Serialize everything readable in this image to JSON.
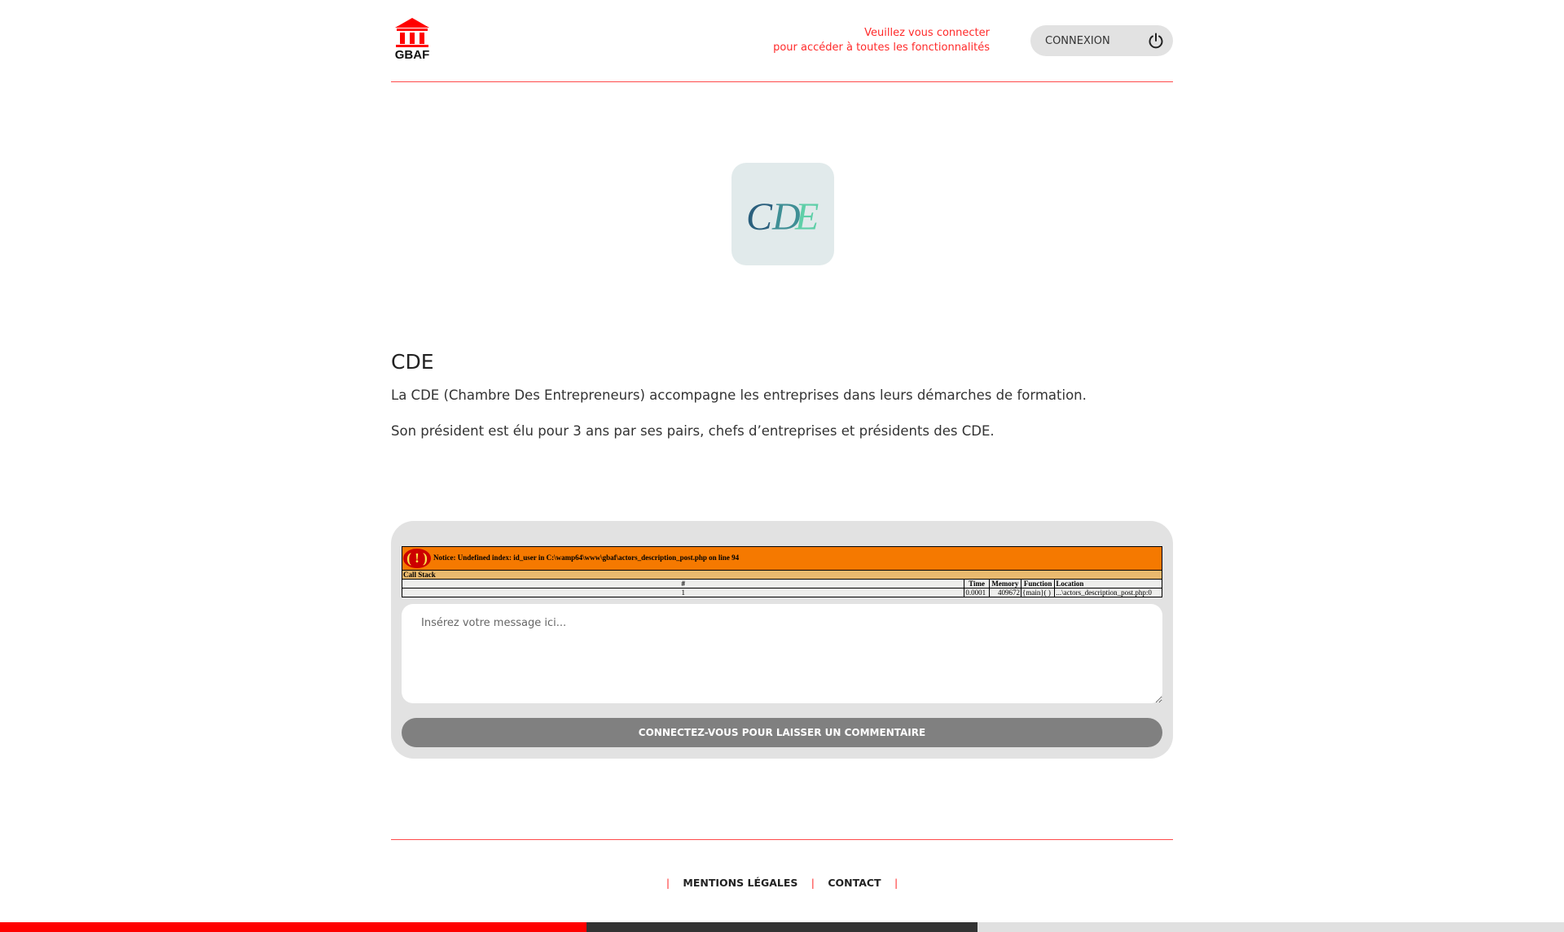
{
  "header": {
    "logo_text": "GBAF",
    "login_message_line1": "Veuillez vous connecter",
    "login_message_line2": "pour accéder à toutes les fonctionnalités",
    "login_button_label": "CONNEXION"
  },
  "actor": {
    "logo_text": "CDE",
    "title": "CDE",
    "paragraphs": [
      "La CDE (Chambre Des Entrepreneurs) accompagne les entreprises dans leurs démarches de formation.",
      "Son président est élu pour 3 ans par ses pairs, chefs d’entreprises et présidents des CDE."
    ]
  },
  "notice": {
    "icon": "( ! )",
    "message": "Notice: Undefined index: id_user in C:\\wamp64\\www\\gbaf\\actors_description_post.php on line 94",
    "call_stack_label": "Call Stack",
    "columns": [
      "#",
      "Time",
      "Memory",
      "Function",
      "Location"
    ],
    "row": [
      "1",
      "0.0001",
      "409672",
      "{main}( )",
      "...\\actors_description_post.php:0"
    ]
  },
  "comment": {
    "placeholder": "Insérez votre message ici...",
    "submit_label": "CONNECTEZ-VOUS POUR LAISSER UN COMMENTAIRE"
  },
  "footer": {
    "separator": "|",
    "links": [
      "MENTIONS LÉGALES",
      "CONTACT"
    ]
  },
  "colors": {
    "accent_red": "#ff2a2a",
    "bar_red": "#ff0000",
    "bar_dark": "#333333",
    "bar_light": "#e0e0e0",
    "cde_dark": "#2a5f7d",
    "cde_light": "#5fcfa8"
  },
  "icons": {
    "logo": "bank-building-icon",
    "login": "power-icon",
    "notice": "warning-icon"
  }
}
